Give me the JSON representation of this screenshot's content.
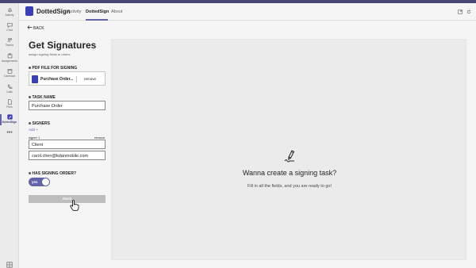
{
  "rail": {
    "items": [
      {
        "label": "Activity",
        "icon": "bell-icon"
      },
      {
        "label": "Chat",
        "icon": "chat-icon"
      },
      {
        "label": "Teams",
        "icon": "teams-icon"
      },
      {
        "label": "Assignments",
        "icon": "assignments-icon"
      },
      {
        "label": "Calendar",
        "icon": "calendar-icon"
      },
      {
        "label": "Calls",
        "icon": "phone-icon"
      },
      {
        "label": "Files",
        "icon": "file-icon"
      },
      {
        "label": "DottedSign",
        "icon": "dottedsign-icon"
      }
    ],
    "more": "•••"
  },
  "header": {
    "app_name": "DottedSign",
    "tabs": [
      "Activity",
      "DottedSign",
      "About"
    ],
    "active_tab": "DottedSign"
  },
  "form": {
    "back_label": "BACK",
    "title": "Get Signatures",
    "subtitle": "assign signing fields to others",
    "pdf_label": "PDF FILE FOR SIGNING",
    "file_name": "Purchase Order...",
    "file_remove": "remove",
    "task_label": "TASK NAME",
    "task_value": "Purchase Order",
    "signers_label": "SIGNERS",
    "add_label": "Add +",
    "signer_caption": "signer 1",
    "signer_remove": "remove",
    "signer_name": "Client",
    "signer_email": "carol.chen@kdanmobile.com",
    "order_label": "HAS SIGNING ORDER?",
    "toggle_text": "yes",
    "toggle_on": true,
    "start_label": "Start!"
  },
  "preview": {
    "title": "Wanna create a signing task?",
    "text": "Fill in all the fields, and you are ready to go!"
  },
  "colors": {
    "accent": "#6264a7",
    "brand": "#3b3fb6",
    "disabled": "#bdbdbd"
  }
}
